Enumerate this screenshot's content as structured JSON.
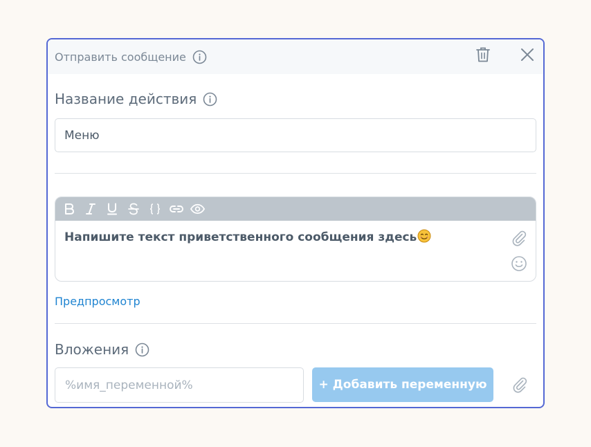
{
  "header": {
    "title": "Отправить сообщение"
  },
  "name_field": {
    "label": "Название действия",
    "value": "Меню"
  },
  "editor": {
    "toolbar": [
      "bold-icon",
      "italic-icon",
      "underline-icon",
      "strikethrough-icon",
      "code-braces-icon",
      "link-icon",
      "eye-icon"
    ],
    "text": "Напишите текст приветственного сообщения здесь",
    "emoji": "smiling-face-icon"
  },
  "preview": {
    "label": "Предпросмотр"
  },
  "attachments": {
    "label": "Вложения",
    "variable_placeholder": "%имя_переменной%",
    "add_button": "+ Добавить переменную"
  },
  "colors": {
    "accent_border": "#5468d4",
    "link": "#1f84d1",
    "button": "#97c9ef",
    "toolbar": "#bdc5cc"
  }
}
